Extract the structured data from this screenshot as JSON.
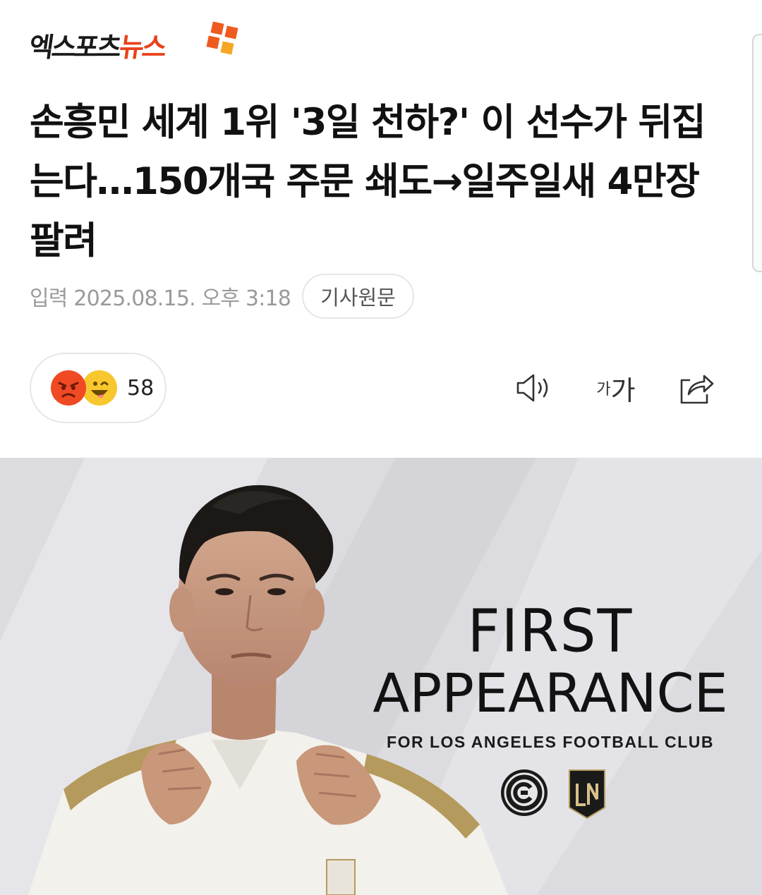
{
  "logo": {
    "part1": "엑스포츠",
    "part2": "뉴스"
  },
  "headline": "손흥민 세계 1위 '3일 천하?' 이 선수가 뒤집는다…150개국 주문 쇄도→일주일새 4만장 팔려",
  "meta": {
    "published": "입력 2025.08.15. 오후 3:18",
    "original_label": "기사원문"
  },
  "reactions": {
    "count": "58",
    "icons": [
      "angry-face-icon",
      "laughing-face-icon"
    ]
  },
  "toolbar": {
    "listen_icon": "speaker-icon",
    "font_small": "가",
    "font_large": "가",
    "share_icon": "share-icon"
  },
  "hero": {
    "title_line1": "FIRST",
    "title_line2": "APPEARANCE",
    "subtitle": "FOR LOS ANGELES FOOTBALL CLUB"
  },
  "colors": {
    "brand_red": "#e8421a",
    "text_primary": "#111111",
    "text_muted": "#9a9a9a"
  }
}
